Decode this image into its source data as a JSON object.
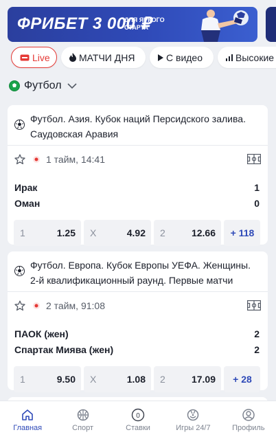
{
  "banner": {
    "title": "ФРИБЕТ 3 000 ₽",
    "subtitle": "ДЛЯ ЯРКОГО СТАРТА"
  },
  "chips": [
    {
      "label": "Live",
      "icon": "live-icon"
    },
    {
      "label": "МАТЧИ ДНЯ",
      "icon": "flame-icon"
    },
    {
      "label": "С видео",
      "icon": "play-icon"
    },
    {
      "label": "Высокие",
      "icon": "bars-icon"
    }
  ],
  "sport_selector": {
    "label": "Футбол",
    "icon": "football-icon"
  },
  "events": [
    {
      "title": "Футбол. Азия. Кубок наций Персидского залива. Саудовская Аравия",
      "status": "1 тайм, 14:41",
      "team1": "Ирак",
      "score1": "1",
      "team2": "Оман",
      "score2": "0",
      "odds": [
        {
          "label": "1",
          "value": "1.25"
        },
        {
          "label": "X",
          "value": "4.92"
        },
        {
          "label": "2",
          "value": "12.66"
        }
      ],
      "more": "+ 118"
    },
    {
      "title": "Футбол. Европа. Кубок Европы УЕФА. Женщины. 2-й квалификационный раунд. Первые матчи",
      "status": "2 тайм, 91:08",
      "team1": "ПАОК (жен)",
      "score1": "2",
      "team2": "Спартак Миява (жен)",
      "score2": "2",
      "odds": [
        {
          "label": "1",
          "value": "9.50"
        },
        {
          "label": "X",
          "value": "1.08"
        },
        {
          "label": "2",
          "value": "17.09"
        }
      ],
      "more": "+ 28"
    }
  ],
  "bottom_nav": [
    {
      "label": "Главная",
      "icon": "home-icon",
      "active": true
    },
    {
      "label": "Спорт",
      "icon": "ball-icon"
    },
    {
      "label": "Ставки",
      "icon": "bets-icon",
      "badge": "0"
    },
    {
      "label": "Игры 24/7",
      "icon": "dice-icon"
    },
    {
      "label": "Профиль",
      "icon": "profile-icon"
    }
  ],
  "colors": {
    "accent": "#2f4ab8",
    "live": "#e53935",
    "background": "#eef0f4"
  }
}
